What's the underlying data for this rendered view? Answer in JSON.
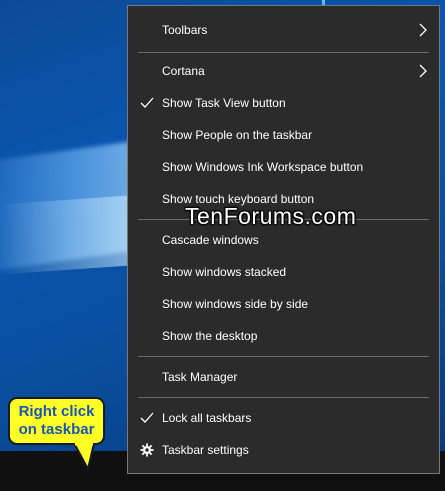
{
  "menu": {
    "items": [
      {
        "label": "Toolbars",
        "checked": false,
        "submenu": true
      },
      {
        "label": "Cortana",
        "checked": false,
        "submenu": true
      },
      {
        "label": "Show Task View button",
        "checked": true,
        "submenu": false
      },
      {
        "label": "Show People on the taskbar",
        "checked": false,
        "submenu": false
      },
      {
        "label": "Show Windows Ink Workspace button",
        "checked": false,
        "submenu": false
      },
      {
        "label": "Show touch keyboard button",
        "checked": false,
        "submenu": false
      },
      {
        "label": "Cascade windows",
        "checked": false,
        "submenu": false
      },
      {
        "label": "Show windows stacked",
        "checked": false,
        "submenu": false
      },
      {
        "label": "Show windows side by side",
        "checked": false,
        "submenu": false
      },
      {
        "label": "Show the desktop",
        "checked": false,
        "submenu": false
      },
      {
        "label": "Task Manager",
        "checked": false,
        "submenu": false
      },
      {
        "label": "Lock all taskbars",
        "checked": true,
        "submenu": false
      },
      {
        "label": "Taskbar settings",
        "checked": false,
        "submenu": false,
        "icon": "gear-icon"
      }
    ]
  },
  "callout": {
    "line1": "Right click",
    "line2": "on taskbar"
  },
  "watermark": "TenForums.com",
  "colors": {
    "menu_bg": "#2b2b2b",
    "menu_border": "#787878",
    "callout_bg": "#ffff26",
    "callout_text": "#1a56b5",
    "taskbar": "#101010"
  }
}
